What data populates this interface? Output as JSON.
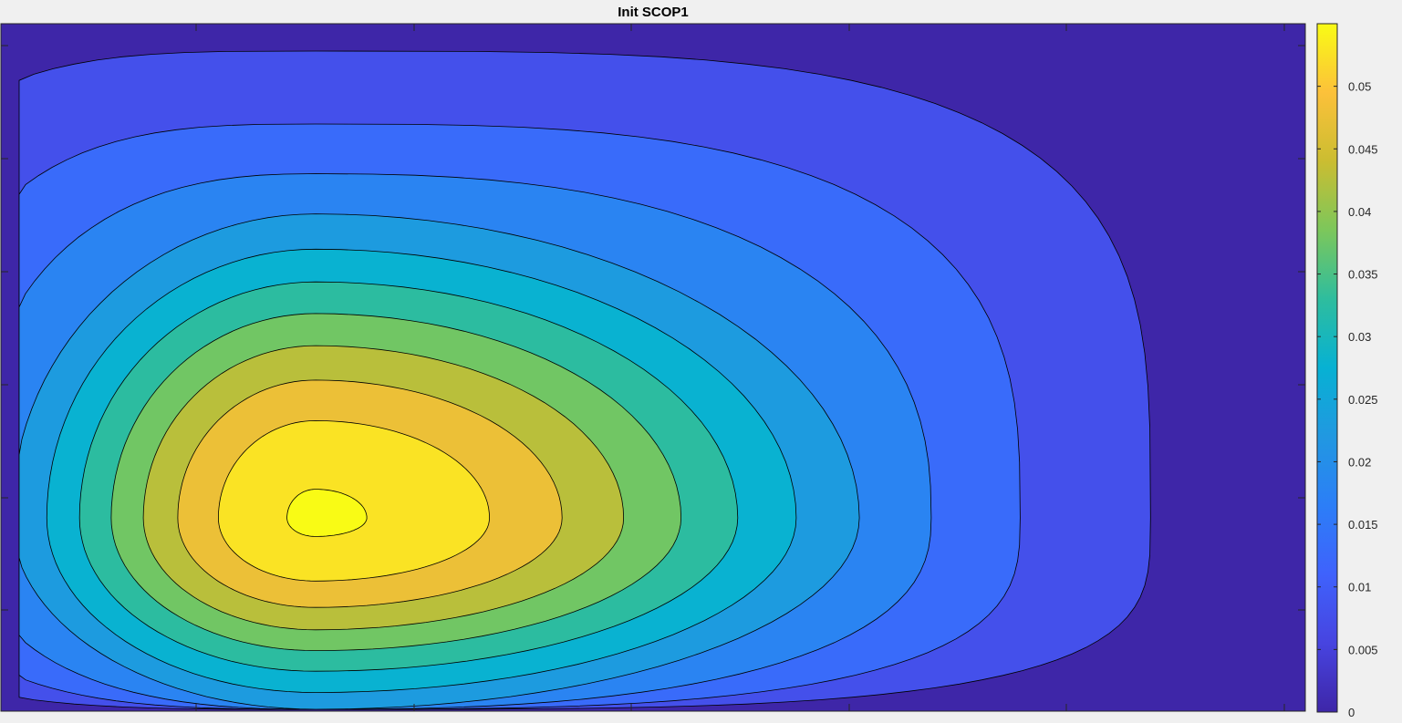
{
  "chart_data": {
    "type": "contourf",
    "title": "Init SCOP1",
    "xlabel": "",
    "ylabel": "",
    "colormap": "parula",
    "color_limits": [
      0,
      0.055
    ],
    "contour_levels": [
      0.005,
      0.01,
      0.015,
      0.02,
      0.025,
      0.03,
      0.035,
      0.04,
      0.045,
      0.05,
      0.055
    ],
    "field": {
      "peak_value": 0.0555,
      "peak_location": "left-of-center, lower half"
    },
    "colorbar": {
      "location": "right",
      "ticks": [
        0,
        0.005,
        0.01,
        0.015,
        0.02,
        0.025,
        0.03,
        0.035,
        0.04,
        0.045,
        0.05
      ],
      "tick_labels": [
        "0",
        "0.005",
        "0.01",
        "0.015",
        "0.02",
        "0.025",
        "0.03",
        "0.035",
        "0.04",
        "0.045",
        "0.05"
      ]
    },
    "grid": false
  }
}
